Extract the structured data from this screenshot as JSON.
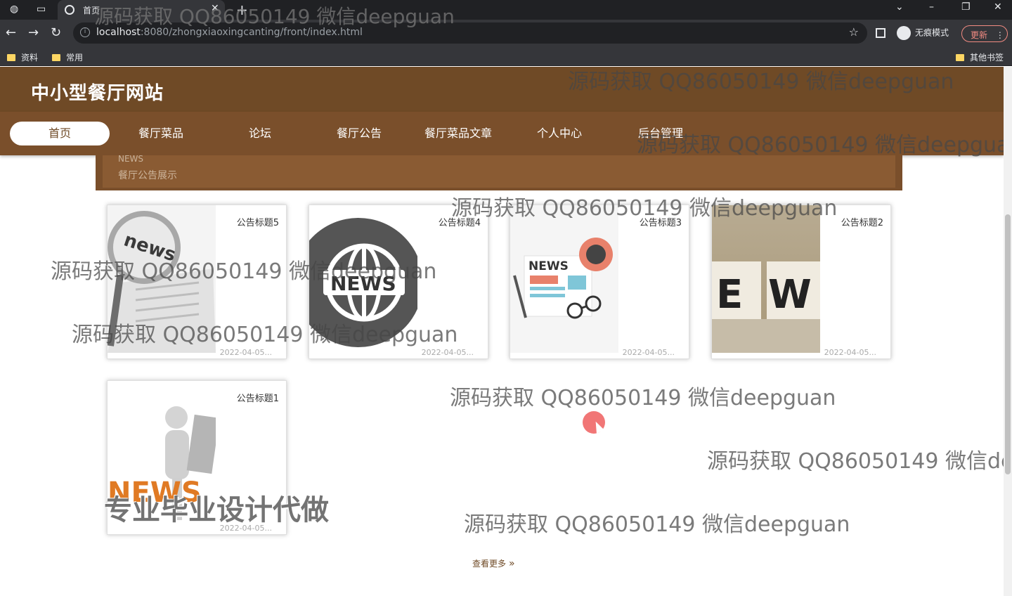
{
  "browser": {
    "tab_title": "首页",
    "url_host": "localhost",
    "url_path": ":8080/zhongxiaoxingcanting/front/index.html",
    "incognito_label": "无痕模式",
    "update_label": "更新",
    "bookmarks": [
      "资料",
      "常用"
    ],
    "other_bookmarks": "其他书签"
  },
  "site": {
    "title": "中小型餐厅网站",
    "nav": [
      "首页",
      "餐厅菜品",
      "论坛",
      "餐厅公告",
      "餐厅菜品文章",
      "个人中心",
      "后台管理"
    ],
    "active_nav": "首页"
  },
  "section": {
    "en": "NEWS",
    "cn": "餐厅公告展示"
  },
  "notices": [
    {
      "title": "公告标题5",
      "date": "2022-04-05...",
      "image": "news-magnifier"
    },
    {
      "title": "公告标题4",
      "date": "2022-04-05...",
      "image": "news-globe"
    },
    {
      "title": "公告标题3",
      "date": "2022-04-05...",
      "image": "news-paper-glasses"
    },
    {
      "title": "公告标题2",
      "date": "2022-04-05...",
      "image": "news-blocks"
    },
    {
      "title": "公告标题1",
      "date": "2022-04-05...",
      "image": "news-figure"
    }
  ],
  "more_label": "查看更多",
  "watermark": "源码获取 QQ86050149 微信deepguan",
  "promo_watermark": "专业毕业设计代做",
  "colors": {
    "header": "#6f4a26",
    "nav": "#7a4f2b",
    "accent": "#ec4848"
  }
}
